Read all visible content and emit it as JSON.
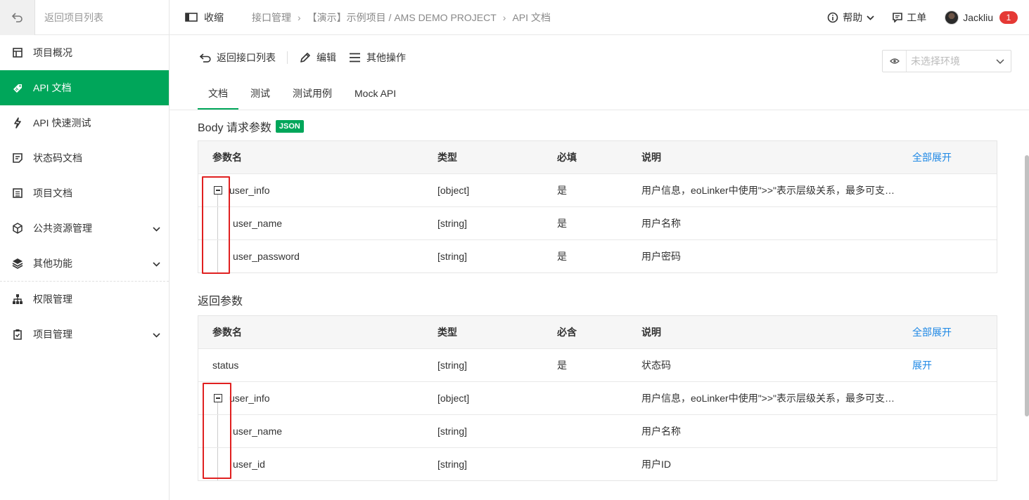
{
  "sidebar": {
    "back_label": "返回项目列表",
    "items": [
      {
        "label": "项目概况",
        "icon": "dashboard-icon"
      },
      {
        "label": "API 文档",
        "icon": "tag-icon",
        "active": true
      },
      {
        "label": "API 快速测试",
        "icon": "bolt-icon"
      },
      {
        "label": "状态码文档",
        "icon": "document-icon"
      },
      {
        "label": "项目文档",
        "icon": "list-icon"
      },
      {
        "label": "公共资源管理",
        "icon": "cube-icon",
        "expandable": true
      },
      {
        "label": "其他功能",
        "icon": "layers-icon",
        "expandable": true
      },
      {
        "label": "权限管理",
        "icon": "sitemap-icon"
      },
      {
        "label": "项目管理",
        "icon": "clipboard-icon",
        "expandable": true
      }
    ]
  },
  "header": {
    "collapse_label": "收缩",
    "breadcrumbs": [
      "接口管理",
      "【演示】示例项目 / AMS DEMO PROJECT",
      "API 文档"
    ],
    "help_label": "帮助",
    "ticket_label": "工单",
    "username": "Jackliu",
    "notification_count": "1"
  },
  "toolbar": {
    "back_label": "返回接口列表",
    "edit_label": "编辑",
    "more_label": "其他操作",
    "env_placeholder": "未选择环境"
  },
  "tabs": [
    "文档",
    "测试",
    "测试用例",
    "Mock API"
  ],
  "body_params": {
    "title": "Body 请求参数",
    "tag": "JSON",
    "headers": [
      "参数名",
      "类型",
      "必填",
      "说明"
    ],
    "expand_all": "全部展开",
    "rows": [
      {
        "name": "user_info",
        "type": "[object]",
        "required": "是",
        "desc": "用户信息，eoLinker中使用\">>\"表示层级关系，最多可支…"
      },
      {
        "name": "user_name",
        "type": "[string]",
        "required": "是",
        "desc": "用户名称"
      },
      {
        "name": "user_password",
        "type": "[string]",
        "required": "是",
        "desc": "用户密码"
      }
    ]
  },
  "response_params": {
    "title": "返回参数",
    "headers": [
      "参数名",
      "类型",
      "必含",
      "说明"
    ],
    "expand_all": "全部展开",
    "rows": [
      {
        "name": "status",
        "type": "[string]",
        "required": "是",
        "desc": "状态码",
        "action": "展开"
      },
      {
        "name": "user_info",
        "type": "[object]",
        "required": "",
        "desc": "用户信息，eoLinker中使用\">>\"表示层级关系，最多可支…"
      },
      {
        "name": "user_name",
        "type": "[string]",
        "required": "",
        "desc": "用户名称"
      },
      {
        "name": "user_id",
        "type": "[string]",
        "required": "",
        "desc": "用户ID"
      }
    ]
  },
  "colors": {
    "accent": "#00a65a",
    "link": "#1e88e5",
    "highlight_box": "#e02020",
    "badge": "#e53935"
  }
}
